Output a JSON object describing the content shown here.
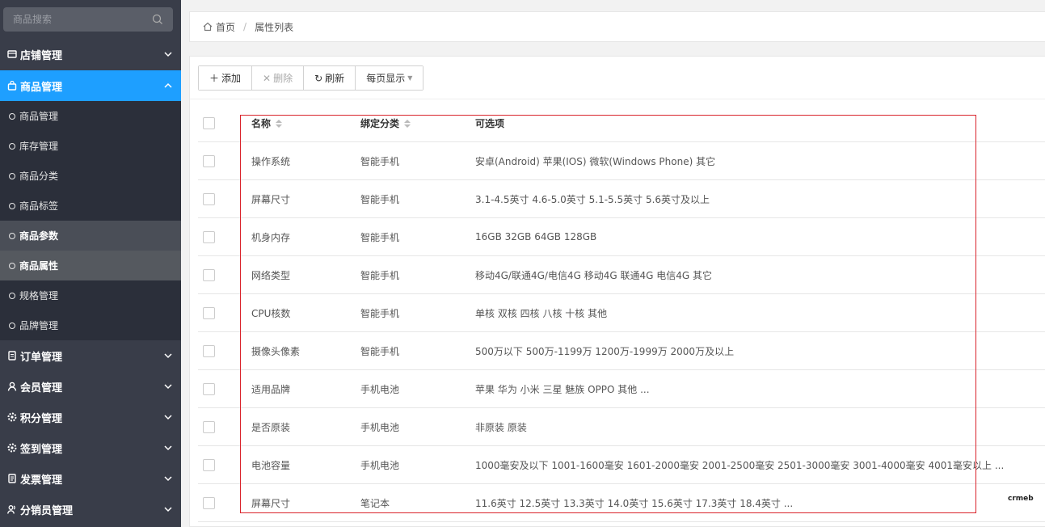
{
  "sidebar": {
    "search_placeholder": "商品搜索",
    "groups": [
      {
        "label": "店铺管理"
      },
      {
        "label": "商品管理"
      },
      {
        "label": "订单管理"
      },
      {
        "label": "会员管理"
      },
      {
        "label": "积分管理"
      },
      {
        "label": "签到管理"
      },
      {
        "label": "发票管理"
      },
      {
        "label": "分销员管理"
      }
    ],
    "sub_items": [
      {
        "label": "商品管理"
      },
      {
        "label": "库存管理"
      },
      {
        "label": "商品分类"
      },
      {
        "label": "商品标签"
      },
      {
        "label": "商品参数"
      },
      {
        "label": "商品属性"
      },
      {
        "label": "规格管理"
      },
      {
        "label": "品牌管理"
      }
    ]
  },
  "breadcrumb": {
    "home": "首页",
    "separator": "/",
    "current": "属性列表"
  },
  "toolbar": {
    "add": "添加",
    "delete": "删除",
    "refresh": "刷新",
    "per_page": "每页显示"
  },
  "table": {
    "headers": {
      "name": "名称",
      "category": "绑定分类",
      "options": "可选项"
    },
    "rows": [
      {
        "name": "操作系统",
        "category": "智能手机",
        "options": "安卓(Android) 苹果(IOS) 微软(Windows Phone) 其它"
      },
      {
        "name": "屏幕尺寸",
        "category": "智能手机",
        "options": "3.1-4.5英寸 4.6-5.0英寸 5.1-5.5英寸 5.6英寸及以上"
      },
      {
        "name": "机身内存",
        "category": "智能手机",
        "options": "16GB 32GB 64GB 128GB"
      },
      {
        "name": "网络类型",
        "category": "智能手机",
        "options": "移动4G/联通4G/电信4G 移动4G 联通4G 电信4G 其它"
      },
      {
        "name": "CPU核数",
        "category": "智能手机",
        "options": "单核 双核 四核 八核 十核 其他"
      },
      {
        "name": "摄像头像素",
        "category": "智能手机",
        "options": "500万以下 500万-1199万 1200万-1999万 2000万及以上"
      },
      {
        "name": "适用品牌",
        "category": "手机电池",
        "options": "苹果 华为 小米 三星 魅族 OPPO 其他 ..."
      },
      {
        "name": "是否原装",
        "category": "手机电池",
        "options": "非原装 原装"
      },
      {
        "name": "电池容量",
        "category": "手机电池",
        "options": "1000毫安及以下 1001-1600毫安 1601-2000毫安 2001-2500毫安 2501-3000毫安 3001-4000毫安 4001毫安以上 ..."
      },
      {
        "name": "屏幕尺寸",
        "category": "笔记本",
        "options": "11.6英寸 12.5英寸 13.3英寸 14.0英寸 15.6英寸 17.3英寸 18.4英寸 ..."
      }
    ]
  },
  "watermark": "crmeb",
  "colors": {
    "sidebar_bg": "#393d49",
    "active_blue": "#1e9fff",
    "highlight_red": "#d9232b"
  }
}
